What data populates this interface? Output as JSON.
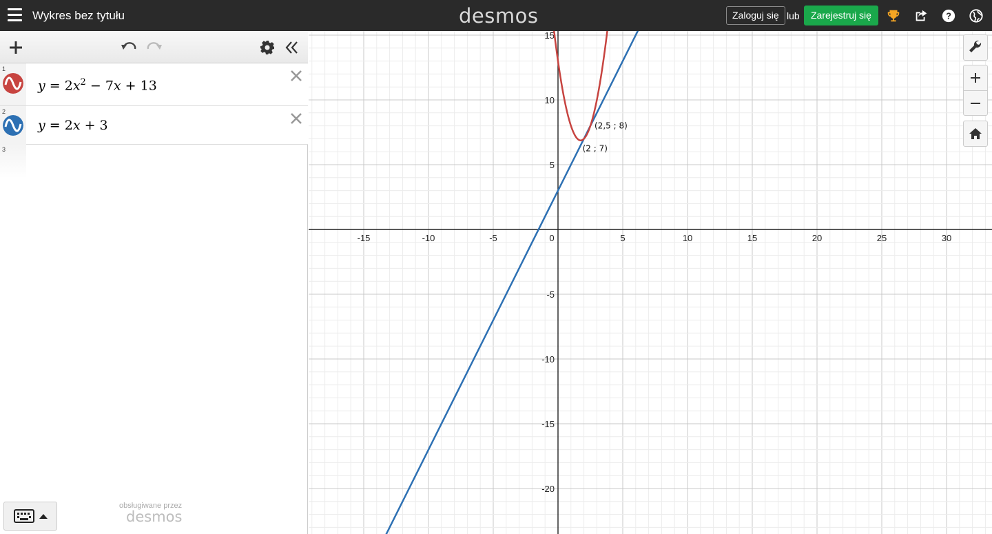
{
  "header": {
    "title": "Wykres bez tytułu",
    "logo": "desmos",
    "login_label": "Zaloguj się",
    "or_label": "lub",
    "signup_label": "Zarejestruj się",
    "icons": [
      "menu-icon",
      "trophy-icon",
      "share-icon",
      "help-icon",
      "globe-icon"
    ]
  },
  "expressions": [
    {
      "number": "1",
      "color": "#c74440"
    },
    {
      "number": "2",
      "color": "#2d70b3"
    },
    {
      "number": "3",
      "color": ""
    }
  ],
  "footer": {
    "powered_by": "obsługiwane przez",
    "powered_logo": "desmos"
  },
  "graph": {
    "x_ticks": [
      "-15",
      "-10",
      "-5",
      "0",
      "5",
      "10",
      "15",
      "20",
      "25",
      "30"
    ],
    "y_ticks": [
      "15",
      "10",
      "5",
      "-5",
      "-10",
      "-15",
      "-20"
    ],
    "points": [
      {
        "label": "(2,5 ; 8)",
        "x": 2.5,
        "y": 8
      },
      {
        "label": "(2 ; 7)",
        "x": 2,
        "y": 7
      }
    ],
    "curve_colors": {
      "parabola": "#c74440",
      "line": "#2d70b3"
    }
  }
}
